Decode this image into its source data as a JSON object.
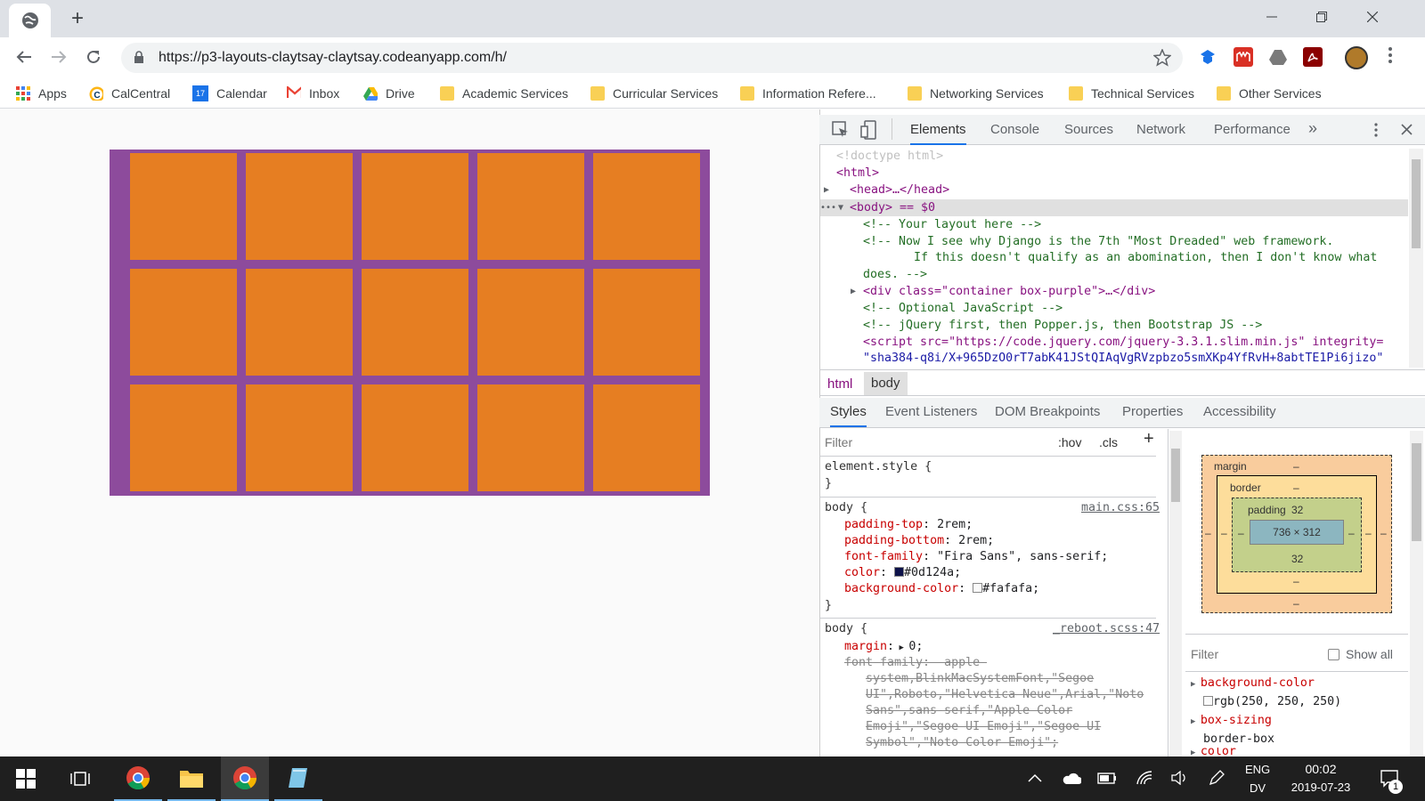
{
  "browser": {
    "tab_icon": "globe-icon",
    "new_tab": "+",
    "url": "https://p3-layouts-claytsay-claytsay.codeanyapp.com/h/",
    "bookmarks": [
      {
        "label": "Apps",
        "icon": "apps-grid-icon"
      },
      {
        "label": "CalCentral",
        "icon": "calcentral-icon"
      },
      {
        "label": "Calendar",
        "icon": "calendar-icon",
        "badge": "17"
      },
      {
        "label": "Inbox",
        "icon": "gmail-icon"
      },
      {
        "label": "Drive",
        "icon": "drive-icon"
      },
      {
        "label": "Academic Services",
        "icon": "folder-icon"
      },
      {
        "label": "Curricular Services",
        "icon": "folder-icon"
      },
      {
        "label": "Information Refere...",
        "icon": "folder-icon"
      },
      {
        "label": "Networking Services",
        "icon": "folder-icon"
      },
      {
        "label": "Technical Services",
        "icon": "folder-icon"
      },
      {
        "label": "Other Services",
        "icon": "folder-icon"
      }
    ]
  },
  "page": {
    "grid_rows": 3,
    "grid_cols": 5,
    "colors": {
      "container": "#8d4b9c",
      "box": "#e67e22",
      "background": "#fafafa"
    }
  },
  "devtools": {
    "tabs": [
      "Elements",
      "Console",
      "Sources",
      "Network",
      "Performance"
    ],
    "more": "»",
    "elements_lines": [
      "<!doctype html>",
      "<html>",
      "<head>…</head>",
      "<body> == $0",
      "<!-- Your layout here -->",
      "<!-- Now I see why Django is the 7th \"Most Dreaded\" web framework.",
      "If this doesn't qualify as an abomination, then I don't know what",
      "does. -->",
      "<div class=\"container box-purple\">…</div>",
      "<!-- Optional JavaScript -->",
      "<!-- jQuery first, then Popper.js, then Bootstrap JS -->",
      "<script src=\"https://code.jquery.com/jquery-3.3.1.slim.min.js\" integrity=",
      "\"sha384-q8i/X+965DzO0rT7abK41JStQIAqVgRVzpbzo5smXKp4YfRvH+8abtTE1Pi6jizo\""
    ],
    "breadcrumbs": [
      "html",
      "body"
    ],
    "subtabs": [
      "Styles",
      "Event Listeners",
      "DOM Breakpoints",
      "Properties",
      "Accessibility"
    ],
    "styles": {
      "filter_placeholder": "Filter",
      "hov": ":hov",
      "cls": ".cls",
      "add": "+",
      "element_style": "element.style {",
      "close_brace": "}",
      "rule1_selector": "body {",
      "rule1_source": "main.css:65",
      "rule1_props": [
        {
          "name": "padding-top",
          "value": "2rem;"
        },
        {
          "name": "padding-bottom",
          "value": "2rem;"
        },
        {
          "name": "font-family",
          "value": "\"Fira Sans\", sans-serif;"
        },
        {
          "name": "color",
          "value": "#0d124a;",
          "swatch": "#0d124a"
        },
        {
          "name": "background-color",
          "value": "#fafafa;",
          "swatch": "#fafafa"
        }
      ],
      "rule2_selector": "body {",
      "rule2_source": "_reboot.scss:47",
      "rule2_margin": "margin",
      "rule2_margin_value": "0;",
      "rule2_strike": [
        "font-family: -apple-",
        "system,BlinkMacSystemFont,\"Segoe",
        "UI\",Roboto,\"Helvetica Neue\",Arial,\"Noto",
        "Sans\",sans-serif,\"Apple Color",
        "Emoji\",\"Segoe UI Emoji\",\"Segoe UI",
        "Symbol\",\"Noto Color Emoji\";"
      ]
    },
    "box_model": {
      "margin_label": "margin",
      "margin_value": "–",
      "border_label": "border",
      "border_value": "–",
      "padding_label": "padding",
      "padding_top": "32",
      "padding_bottom": "32",
      "content": "736 × 312",
      "side": "–"
    },
    "computed": {
      "filter_placeholder": "Filter",
      "show_all": "Show all",
      "props": [
        {
          "name": "background-color",
          "value": "rgb(250, 250, 250)"
        },
        {
          "name": "box-sizing",
          "value": "border-box"
        },
        {
          "name": "color",
          "value": ""
        }
      ]
    }
  },
  "taskbar": {
    "lang_top": "ENG",
    "lang_bottom": "DV",
    "time": "00:02",
    "date": "2019-07-23",
    "notifications": "1"
  }
}
